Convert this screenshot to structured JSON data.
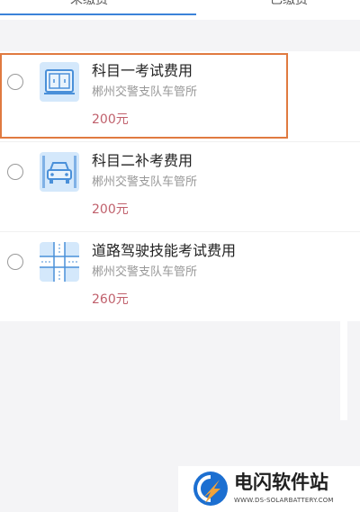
{
  "tabs": [
    {
      "label": "未缴费"
    },
    {
      "label": "已缴费"
    }
  ],
  "fees": [
    {
      "title": "科目一考试费用",
      "org": "郴州交警支队车管所",
      "price": "200元",
      "icon": "exam-room-icon"
    },
    {
      "title": "科目二补考费用",
      "org": "郴州交警支队车管所",
      "price": "200元",
      "icon": "car-icon"
    },
    {
      "title": "道路驾驶技能考试费用",
      "org": "郴州交警支队车管所",
      "price": "260元",
      "icon": "road-intersection-icon"
    }
  ],
  "watermark": {
    "name": "电闪软件站",
    "url": "WWW.DS-SOLARBATTERY.COM"
  },
  "colors": {
    "accent": "#3b82d9",
    "price": "#c0606c",
    "highlight": "#e07a40",
    "icon_bg": "#d4e8fb"
  }
}
